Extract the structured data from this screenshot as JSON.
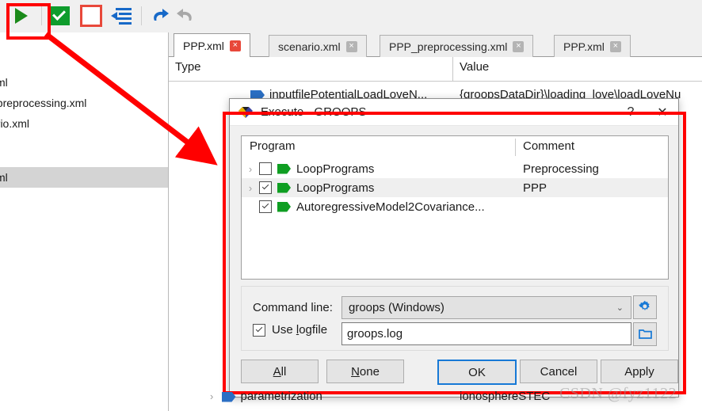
{
  "toolbar": {
    "buttons": [
      {
        "name": "run-button",
        "icon": "play-icon",
        "title": "Run"
      },
      {
        "name": "validate-button",
        "icon": "check-icon",
        "title": "Check"
      },
      {
        "name": "stop-button",
        "icon": "stop-icon",
        "title": "Stop"
      },
      {
        "name": "indent-button",
        "icon": "indent-icon",
        "title": "Indent"
      },
      {
        "name": "undo-button",
        "icon": "undo-icon",
        "title": "Undo"
      },
      {
        "name": "redo-button",
        "icon": "redo-icon",
        "title": "Redo"
      }
    ]
  },
  "sidebar": {
    "items": [
      {
        "label": "xml",
        "selected": false
      },
      {
        "label": "_preprocessing.xml",
        "selected": false
      },
      {
        "label": "ario.xml",
        "selected": false
      },
      {
        "label": "xml",
        "selected": true
      }
    ]
  },
  "editor": {
    "tabs": [
      {
        "label": "PPP.xml",
        "active": true,
        "close": "×"
      },
      {
        "label": "scenario.xml",
        "active": false,
        "close": "×"
      },
      {
        "label": "PPP_preprocessing.xml",
        "active": false,
        "close": "×"
      },
      {
        "label": "PPP.xml",
        "active": false,
        "close": "×"
      }
    ],
    "columns": {
      "type": "Type",
      "value": "Value"
    },
    "rows": [
      {
        "type": "inputfilePotentialLoadLoveN...",
        "value": "{groopsDataDir}\\loading_love\\loadLoveNu"
      },
      {
        "type": "parametrization",
        "value": "ionosphereSTEC"
      }
    ]
  },
  "dialog": {
    "title": "Execute - GROOPS",
    "icon": "gem-icon",
    "help_label": "?",
    "close_label": "✕",
    "tree": {
      "headers": {
        "program": "Program",
        "comment": "Comment"
      },
      "rows": [
        {
          "twisty": "›",
          "checked": false,
          "program": "LoopPrograms",
          "comment": "Preprocessing"
        },
        {
          "twisty": "›",
          "checked": true,
          "program": "LoopPrograms",
          "comment": "PPP"
        },
        {
          "twisty": "",
          "checked": true,
          "program": "AutoregressiveModel2Covariance...",
          "comment": ""
        }
      ]
    },
    "command_line": {
      "label": "Command line:",
      "value": "groops (Windows)",
      "caret": "⌄",
      "settings_icon": "gear-icon"
    },
    "logfile": {
      "checkbox_checked": true,
      "label_prefix": "Use ",
      "label_accel": "l",
      "label_suffix": "ogfile",
      "value": "groops.log",
      "browse_icon": "folder-icon"
    },
    "buttons": [
      {
        "name": "all-button",
        "accel": "A",
        "rest": "ll",
        "focus": false
      },
      {
        "name": "none-button",
        "accel": "N",
        "rest": "one",
        "focus": false
      },
      {
        "name": "ok-button",
        "accel": "",
        "rest": "OK",
        "focus": true
      },
      {
        "name": "cancel-button",
        "accel": "",
        "rest": "Cancel",
        "focus": false
      },
      {
        "name": "apply-button",
        "accel": "",
        "rest": "Apply",
        "focus": false
      }
    ]
  },
  "annotations": {
    "watermark": "CSDN @fyz1122",
    "accent_color": "#ff0000"
  }
}
